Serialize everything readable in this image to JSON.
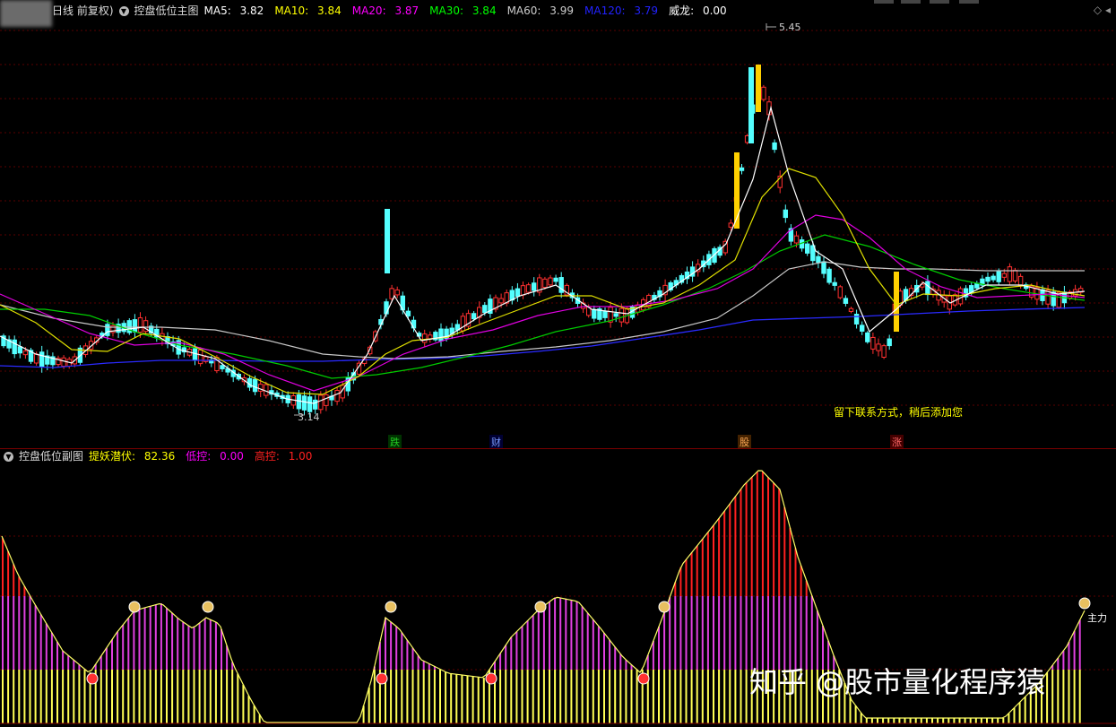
{
  "main_header": {
    "period": "日线 前复权)",
    "indicator": "控盘低位主图",
    "ma5": {
      "label": "MA5:",
      "value": "3.82",
      "color": "#ffffff"
    },
    "ma10": {
      "label": "MA10:",
      "value": "3.84",
      "color": "#ffff00"
    },
    "ma20": {
      "label": "MA20:",
      "value": "3.87",
      "color": "#ff00ff"
    },
    "ma30": {
      "label": "MA30:",
      "value": "3.84",
      "color": "#00ff00"
    },
    "ma60": {
      "label": "MA60:",
      "value": "3.99",
      "color": "#cccccc"
    },
    "ma120": {
      "label": "MA120:",
      "value": "3.79",
      "color": "#0000ff"
    },
    "wl": {
      "label": "威龙:",
      "value": "0.00",
      "color": "#ffffff"
    }
  },
  "annotations": {
    "peak": "5.45",
    "low": "3.14",
    "contact": "留下联系方式，稍后添加您"
  },
  "events": [
    {
      "text": "跌",
      "color": "#22cc22",
      "bg": "#003300"
    },
    {
      "text": "财",
      "color": "#7799ff",
      "bg": "#000033"
    },
    {
      "text": "股",
      "color": "#ffaa55",
      "bg": "#442200"
    },
    {
      "text": "涨",
      "color": "#ff6666",
      "bg": "#440000"
    }
  ],
  "sub_header": {
    "indicator": "控盘低位副图",
    "tiyao": {
      "label": "提妖潜伏:",
      "value": "82.36",
      "color": "#ffff00"
    },
    "dikong": {
      "label": "低控:",
      "value": "0.00",
      "color": "#ff00ff"
    },
    "gaokong": {
      "label": "高控:",
      "value": "1.00",
      "color": "#ff0000"
    }
  },
  "side_label": "主力",
  "watermark": "知乎 @股市量化程序猿",
  "colors": {
    "up": "#ff3030",
    "down": "#54ffff",
    "yellow_bar": "#ffd000",
    "grid": "#5a0000"
  }
}
